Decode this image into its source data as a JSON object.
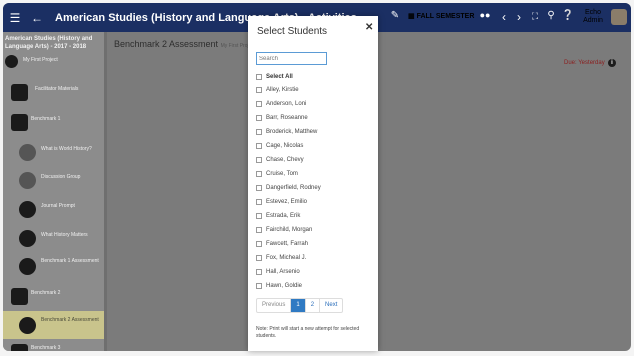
{
  "topbar": {
    "app_title": "American Studies (History and Language Arts) - Activities",
    "semester": "FALL SEMESTER",
    "user_name": "Echo Admin"
  },
  "sidebar": {
    "course_title": "American Studies (History and Language Arts) - 2017 - 2018",
    "items": [
      {
        "label": "My First Project",
        "icon": "project-icon"
      },
      {
        "label": "Facilitator Materials",
        "icon": "folder-icon"
      },
      {
        "label": "Benchmark 1",
        "icon": "folder-open-icon"
      },
      {
        "label": "What is World History?",
        "icon": "photo-icon"
      },
      {
        "label": "Discussion Group",
        "icon": "photo-icon"
      },
      {
        "label": "Journal Prompt",
        "icon": "journal-icon"
      },
      {
        "label": "What History Matters",
        "icon": "document-icon"
      },
      {
        "label": "Benchmark 1 Assessment",
        "icon": "assessment-icon"
      },
      {
        "label": "Benchmark 2",
        "icon": "folder-open-icon"
      },
      {
        "label": "Benchmark 2 Assessment",
        "icon": "assessment-icon"
      },
      {
        "label": "Benchmark 3",
        "icon": "folder-icon"
      }
    ]
  },
  "main": {
    "title": "Benchmark 2 Assessment",
    "subtitle": "My First Proj",
    "due": "Due: Yesterday"
  },
  "modal": {
    "title": "Select Students",
    "search_placeholder": "Search",
    "select_all": "Select All",
    "students": [
      "Alley, Kirstie",
      "Anderson, Loni",
      "Barr, Roseanne",
      "Broderick, Matthew",
      "Cage, Nicolas",
      "Chase, Chevy",
      "Cruise, Tom",
      "Dangerfield, Rodney",
      "Estevez, Emilio",
      "Estrada, Erik",
      "Fairchild, Morgan",
      "Fawcett, Farrah",
      "Fox, Micheal J.",
      "Hall, Arsenio",
      "Hawn, Goldie"
    ],
    "pagination": {
      "previous": "Previous",
      "pages": [
        "1",
        "2"
      ],
      "next": "Next",
      "current": "1"
    },
    "note": "Note: Print will start a new attempt for selected students."
  },
  "colors": {
    "topbar": "#1b2f63",
    "page_active": "#2f7ac3",
    "due": "#8b1e1e"
  }
}
